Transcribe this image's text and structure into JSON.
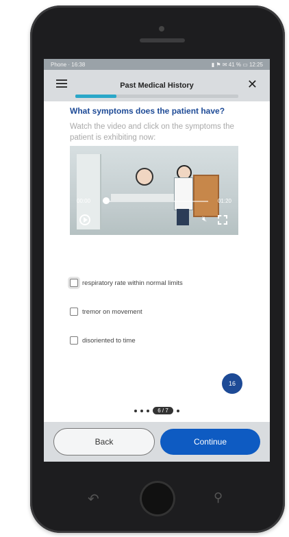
{
  "status_bar": {
    "carrier": "Phone · 16:38",
    "indicators": "▮ ⚑ ✉ 41 % ▭ 12:25"
  },
  "app_bar": {
    "title": "Past Medical History",
    "progress_fraction": 0.25,
    "menu_icon": "hamburger-icon",
    "close_icon": "close-icon"
  },
  "question": {
    "title": "What symptoms does the patient have?",
    "instruction": "Watch the video and click on the symptoms the patient is exhibiting now:"
  },
  "video": {
    "time_current": "00:00",
    "time_total": "01:20",
    "progress_fraction": 0.0
  },
  "options": [
    {
      "label": "respiratory rate within normal limits",
      "checked": false
    },
    {
      "label": "tremor on movement",
      "checked": false
    },
    {
      "label": "disoriented to time",
      "checked": false
    }
  ],
  "fab_label": "16",
  "pager": {
    "label": "6 / 7"
  },
  "footer": {
    "back_label": "Back",
    "continue_label": "Continue"
  },
  "colors": {
    "accent": "#1d4a96",
    "progress": "#2aa7c8",
    "continue": "#0e5bc2"
  }
}
